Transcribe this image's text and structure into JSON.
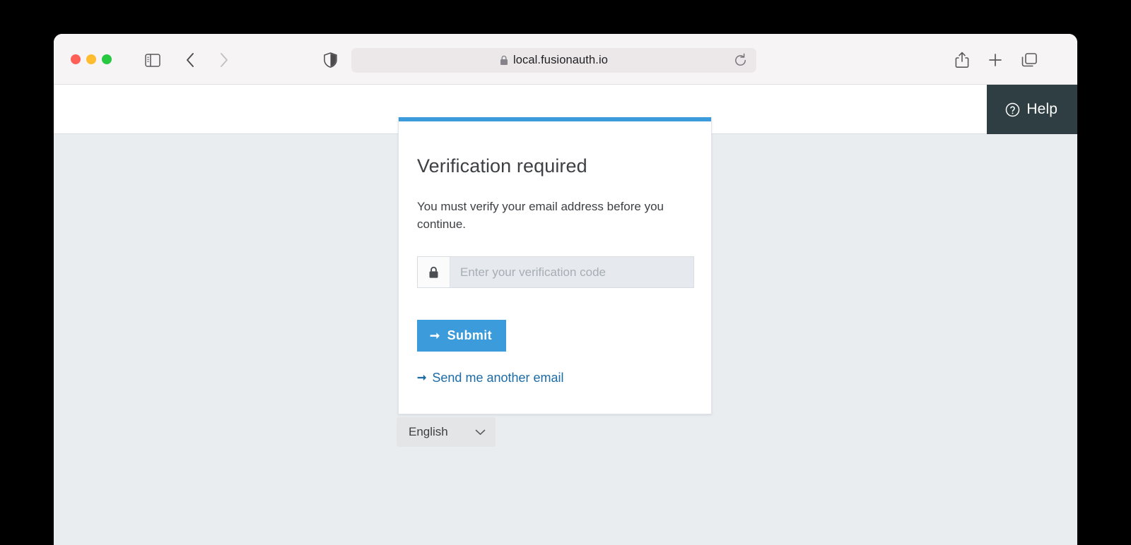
{
  "browser": {
    "traffic_lights": [
      {
        "name": "close",
        "color": "#ff5f57"
      },
      {
        "name": "minimize",
        "color": "#febc2e"
      },
      {
        "name": "zoom",
        "color": "#28c840"
      }
    ],
    "sidebar_icon": "sidebar-icon",
    "back_icon": "chevron-left-icon",
    "forward_icon": "chevron-right-icon",
    "shield_icon": "shield-icon",
    "lock_icon": "lock-icon",
    "url": "local.fusionauth.io",
    "reload_icon": "reload-icon",
    "share_icon": "share-icon",
    "newtab_icon": "plus-icon",
    "tabs_icon": "tab-overview-icon"
  },
  "header": {
    "help_label": "Help",
    "help_icon": "question-circle-icon",
    "help_background": "#2f3e43"
  },
  "card": {
    "accent_color": "#3b9bdb",
    "title": "Verification required",
    "body": "You must verify your email address before you continue.",
    "input": {
      "icon": "lock-icon",
      "placeholder": "Enter your verification code",
      "value": ""
    },
    "submit": {
      "label": "Submit",
      "icon": "arrow-right-icon",
      "color": "#3b9bdb"
    },
    "resend": {
      "label": "Send me another email",
      "icon": "arrow-right-icon",
      "color": "#1c6ba5"
    }
  },
  "language": {
    "selected": "English",
    "chevron_icon": "chevron-down-icon"
  }
}
